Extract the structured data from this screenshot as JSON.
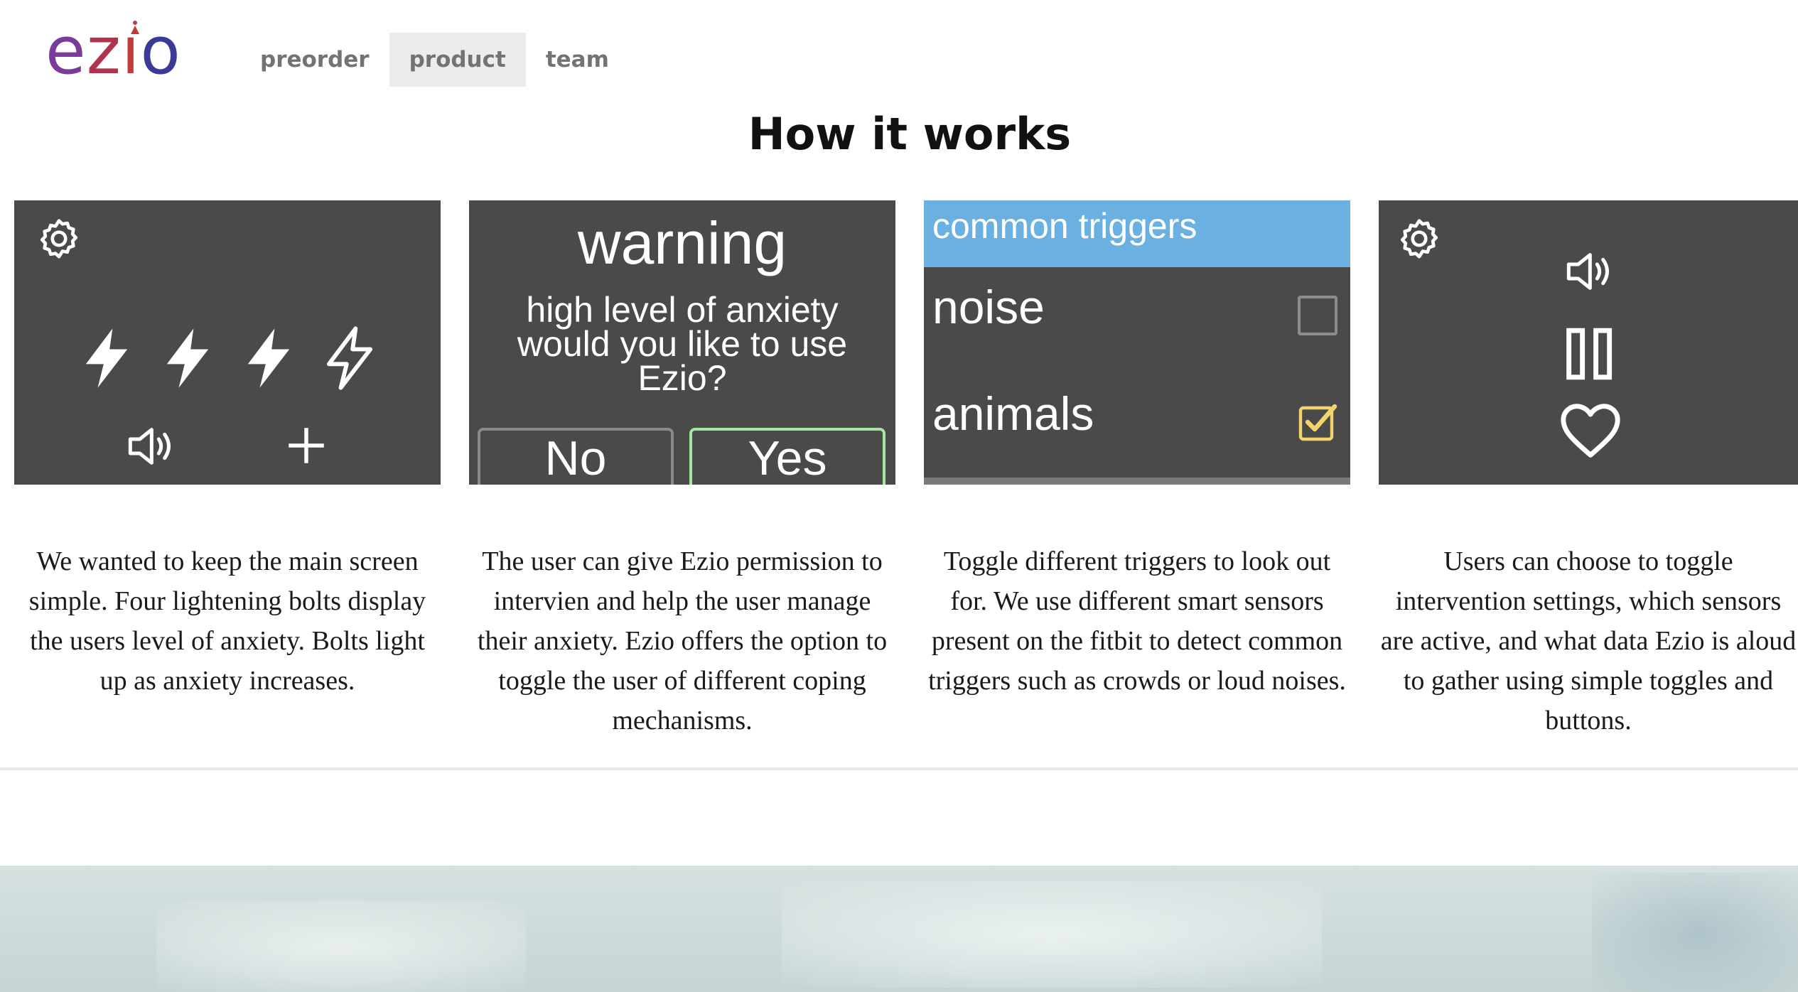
{
  "brand": {
    "logo_text": "ezio",
    "colors": {
      "purple": "#7a3b9a",
      "red": "#c23a3a",
      "navy": "#3a3b97"
    }
  },
  "nav": {
    "items": [
      {
        "label": "preorder",
        "active": false
      },
      {
        "label": "product",
        "active": true
      },
      {
        "label": "team",
        "active": false
      }
    ]
  },
  "section": {
    "title": "How it works"
  },
  "cards": {
    "main_screen": {
      "icons": [
        "gear-icon",
        "bolt-icon",
        "bolt-icon",
        "bolt-icon",
        "bolt-outline-icon",
        "speaker-icon",
        "plus-icon"
      ],
      "anxiety_level": 3,
      "anxiety_max": 4
    },
    "warning": {
      "title": "warning",
      "message": "high level of anxiety would you like to use Ezio?",
      "no_label": "No",
      "yes_label": "Yes"
    },
    "triggers": {
      "header": "common triggers",
      "items": [
        {
          "label": "noise",
          "checked": false
        },
        {
          "label": "animals",
          "checked": true
        }
      ],
      "colors": {
        "header": "#6ab1e2",
        "check": "#f3d36b"
      }
    },
    "settings": {
      "icons": [
        "gear-icon",
        "speaker-icon",
        "pause-icon",
        "heart-icon"
      ]
    }
  },
  "captions": [
    "We wanted to keep the main screen simple. Four lightening bolts display the users level of anxiety. Bolts light up as anxiety increases.",
    "The user can give Ezio permission to intervien and help the user manage their anxiety. Ezio offers the option to toggle the user of different coping mechanisms.",
    "Toggle different triggers to look out for. We use different smart sensors present on the fitbit to detect common triggers such as crowds or loud noises.",
    "Users can choose to toggle intervention settings, which sensors are active, and what data Ezio is aloud to gather using simple toggles and buttons."
  ]
}
